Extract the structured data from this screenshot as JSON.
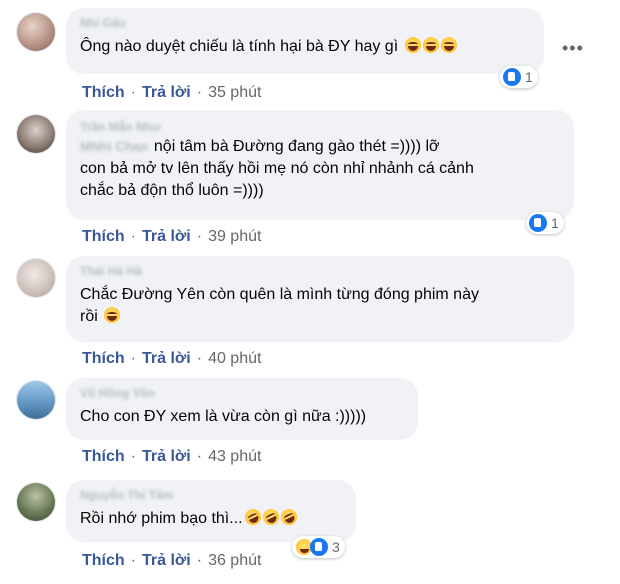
{
  "comments": [
    {
      "name": "Nhi Gấu",
      "text": "Ông nào duyệt chiếu là tính hại bà ĐY hay gì",
      "like_label": "Thích",
      "reply_label": "Trả lời",
      "time": "35 phút",
      "reaction_count": "1"
    },
    {
      "name": "Trần Mẫn Như",
      "name2": "MNhi Chan",
      "text_line1": "nội tâm bà Đường đang gào thét =)))) lỡ",
      "text_line2": "con bả mở tv lên thấy hồi mẹ nó còn nhỉ nhảnh cá cảnh",
      "text_line3": "chắc bả độn thổ luôn =))))",
      "like_label": "Thích",
      "reply_label": "Trả lời",
      "time": "39 phút",
      "reaction_count": "1"
    },
    {
      "name": "Thái Hà Hà",
      "text_line1": "Chắc Đường Yên còn quên là mình từng đóng phim này",
      "text_line2": "rồi",
      "like_label": "Thích",
      "reply_label": "Trả lời",
      "time": "40 phút"
    },
    {
      "name": "Vũ Hồng Vân",
      "text": "Cho con ĐY xem là vừa còn gì nữa :)))))",
      "like_label": "Thích",
      "reply_label": "Trả lời",
      "time": "43 phút"
    },
    {
      "name": "Nguyễn Thị Tâm",
      "text": "Rồi nhớ phim bạo thì...",
      "like_label": "Thích",
      "reply_label": "Trả lời",
      "time": "36 phút",
      "reaction_count": "3"
    }
  ],
  "icons": {
    "more": "more-options-icon",
    "like": "like-reaction-icon",
    "haha": "haha-reaction-icon",
    "laughing_emoji": "laughing-tears-emoji",
    "rofl_emoji": "rolling-laughing-emoji"
  },
  "colors": {
    "bubble": "#f0f2f5",
    "action_link": "#385898",
    "meta_text": "#65676b",
    "like_blue": "#1877f2"
  }
}
